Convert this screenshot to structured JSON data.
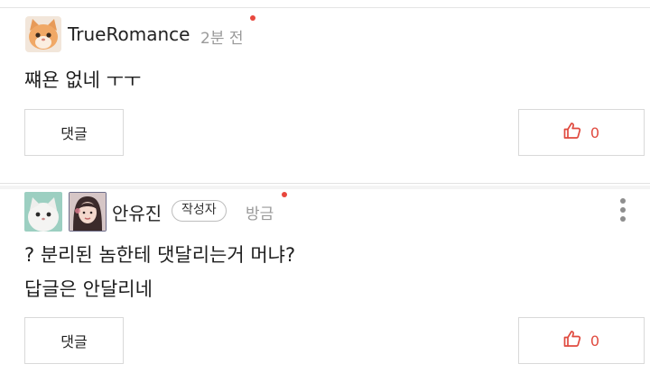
{
  "comments": [
    {
      "author": "TrueRomance",
      "time": "2분 전",
      "body_lines": [
        "쨰욘 없네 ㅜㅜ"
      ],
      "reply_label": "댓글",
      "like_count": "0"
    },
    {
      "author": "안유진",
      "badge": "작성자",
      "time": "방금",
      "body_lines": [
        "? 분리된 놈한테 댓달리는거 머냐?",
        "답글은 안달리네"
      ],
      "reply_label": "댓글",
      "like_count": "0"
    }
  ],
  "colors": {
    "accent": "#e04a3f",
    "new_dot": "#e8473d",
    "muted": "#9a9a9a"
  },
  "icons": {
    "like": "thumbs-up-icon",
    "more": "more-vertical-icon"
  }
}
